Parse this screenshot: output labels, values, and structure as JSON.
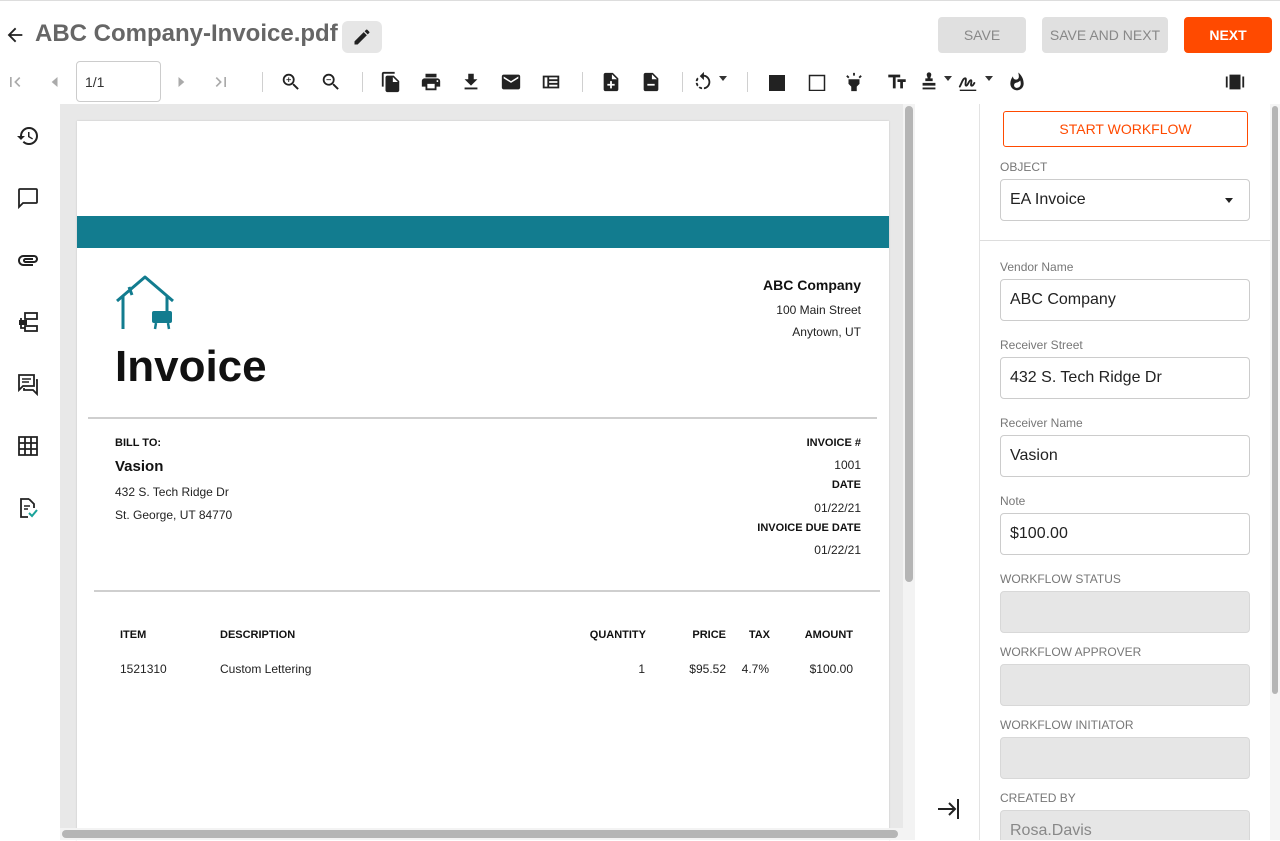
{
  "header": {
    "title": "ABC Company-Invoice.pdf",
    "save_label": "SAVE",
    "save_next_label": "SAVE AND NEXT",
    "next_label": "NEXT"
  },
  "toolbar": {
    "page_value": "1/1",
    "icons": [
      "first-page-icon",
      "prev-page-icon",
      "next-page-icon",
      "last-page-icon",
      "zoom-in-icon",
      "zoom-out-icon",
      "copy-icon",
      "print-icon",
      "download-icon",
      "email-icon",
      "thumbnails-icon",
      "add-page-icon",
      "remove-page-icon",
      "rotate-icon",
      "redact-box-icon",
      "draw-box-icon",
      "highlight-icon",
      "text-icon",
      "stamp-icon",
      "signature-icon",
      "burn-icon",
      "panel-toggle-icon"
    ]
  },
  "rail": {
    "icons": [
      "history-icon",
      "comments-icon",
      "attachments-icon",
      "workflow-icon",
      "chat-icon",
      "table-icon",
      "approval-icon"
    ]
  },
  "document": {
    "company_name": "ABC Company",
    "company_street": "100 Main Street",
    "company_city": "Anytown, UT",
    "heading": "Invoice",
    "bill_to_label": "BILL TO:",
    "bill_to_name": "Vasion",
    "bill_to_street": "432 S. Tech Ridge Dr",
    "bill_to_city": "St. George, UT 84770",
    "invoice_no_label": "INVOICE #",
    "invoice_no": "1001",
    "date_label": "DATE",
    "date": "01/22/21",
    "due_date_label": "INVOICE DUE DATE",
    "due_date": "01/22/21",
    "columns": [
      "ITEM",
      "DESCRIPTION",
      "QUANTITY",
      "PRICE",
      "TAX",
      "AMOUNT"
    ],
    "rows": [
      {
        "item": "1521310",
        "description": "Custom Lettering",
        "quantity": "1",
        "price": "$95.52",
        "tax": "4.7%",
        "amount": "$100.00"
      }
    ]
  },
  "panel": {
    "start_workflow_label": "START WORKFLOW",
    "object_label": "OBJECT",
    "object_value": "EA Invoice",
    "fields": [
      {
        "label": "Vendor Name",
        "value": "ABC Company"
      },
      {
        "label": "Receiver Street",
        "value": "432 S. Tech Ridge Dr"
      },
      {
        "label": "Receiver Name",
        "value": "Vasion"
      },
      {
        "label": "Note",
        "value": "$100.00"
      }
    ],
    "readonly_fields": [
      {
        "label": "WORKFLOW STATUS",
        "value": ""
      },
      {
        "label": "WORKFLOW APPROVER",
        "value": ""
      },
      {
        "label": "WORKFLOW INITIATOR",
        "value": ""
      },
      {
        "label": "CREATED BY",
        "value": "Rosa.Davis"
      }
    ]
  },
  "colors": {
    "accent": "#ff4a00",
    "teal": "#127c8f"
  }
}
